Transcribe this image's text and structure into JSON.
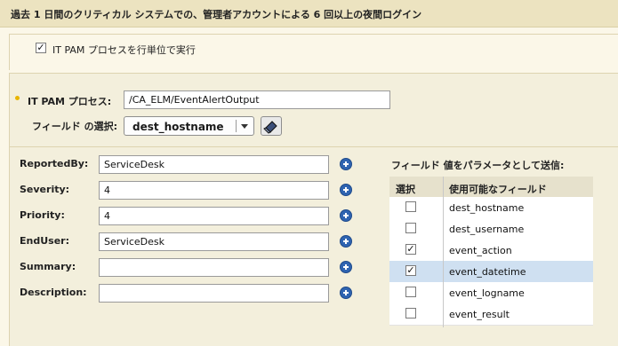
{
  "title": "過去 1 日間のクリティカル システムでの、管理者アカウントによる 6 回以上の夜間ログイン",
  "process_row": {
    "label": "IT PAM プロセスを行単位で実行",
    "checked": true
  },
  "pam": {
    "label": "IT PAM プロセス:",
    "value": "/CA_ELM/EventAlertOutput"
  },
  "field_select": {
    "label": "フィールド の選択:",
    "value": "dest_hostname"
  },
  "form_fields": [
    {
      "label": "ReportedBy:",
      "value": "ServiceDesk"
    },
    {
      "label": "Severity:",
      "value": "4"
    },
    {
      "label": "Priority:",
      "value": "4"
    },
    {
      "label": "EndUser:",
      "value": "ServiceDesk"
    },
    {
      "label": "Summary:",
      "value": ""
    },
    {
      "label": "Description:",
      "value": ""
    }
  ],
  "param_section": {
    "title": "フィールド 値をパラメータとして送信:",
    "col_select": "選択",
    "col_fields": "使用可能なフィールド",
    "rows": [
      {
        "name": "dest_hostname",
        "checked": false,
        "selected": false
      },
      {
        "name": "dest_username",
        "checked": false,
        "selected": false
      },
      {
        "name": "event_action",
        "checked": true,
        "selected": false
      },
      {
        "name": "event_datetime",
        "checked": true,
        "selected": true
      },
      {
        "name": "event_logname",
        "checked": false,
        "selected": false
      },
      {
        "name": "event_result",
        "checked": false,
        "selected": false
      }
    ]
  }
}
